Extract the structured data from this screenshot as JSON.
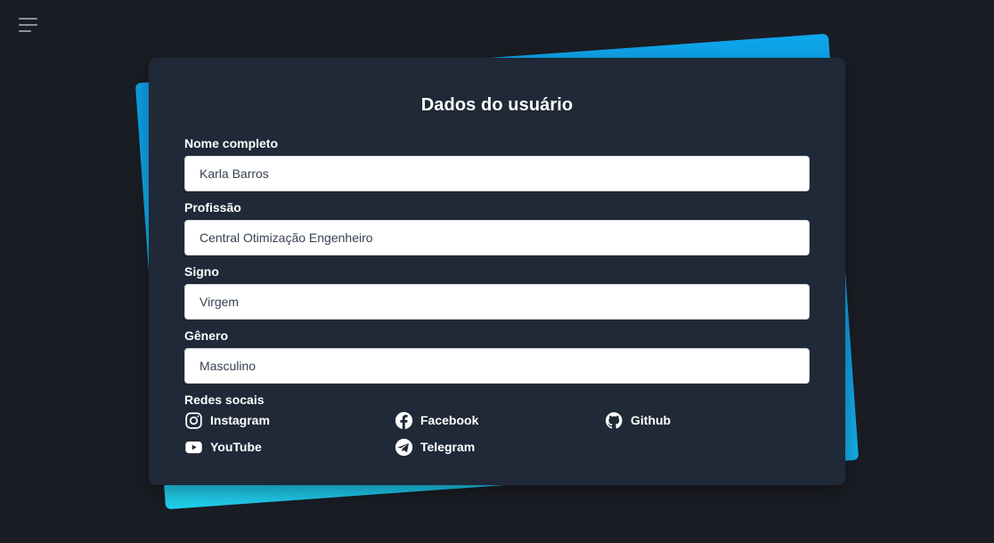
{
  "menu": {
    "icon": "hamburger-menu-icon"
  },
  "card": {
    "title": "Dados do usuário",
    "background": "#1f2937",
    "accent_gradient": [
      "#0ea5e9",
      "#22d3ee"
    ]
  },
  "fields": [
    {
      "label": "Nome completo",
      "value": "Karla Barros"
    },
    {
      "label": "Profissão",
      "value": "Central Otimização Engenheiro"
    },
    {
      "label": "Signo",
      "value": "Virgem"
    },
    {
      "label": "Gênero",
      "value": "Masculino"
    }
  ],
  "socials": {
    "label": "Redes socais",
    "items": [
      {
        "name": "Instagram",
        "icon": "instagram-icon"
      },
      {
        "name": "Facebook",
        "icon": "facebook-icon"
      },
      {
        "name": "Github",
        "icon": "github-icon"
      },
      {
        "name": "YouTube",
        "icon": "youtube-icon"
      },
      {
        "name": "Telegram",
        "icon": "telegram-icon"
      }
    ]
  }
}
